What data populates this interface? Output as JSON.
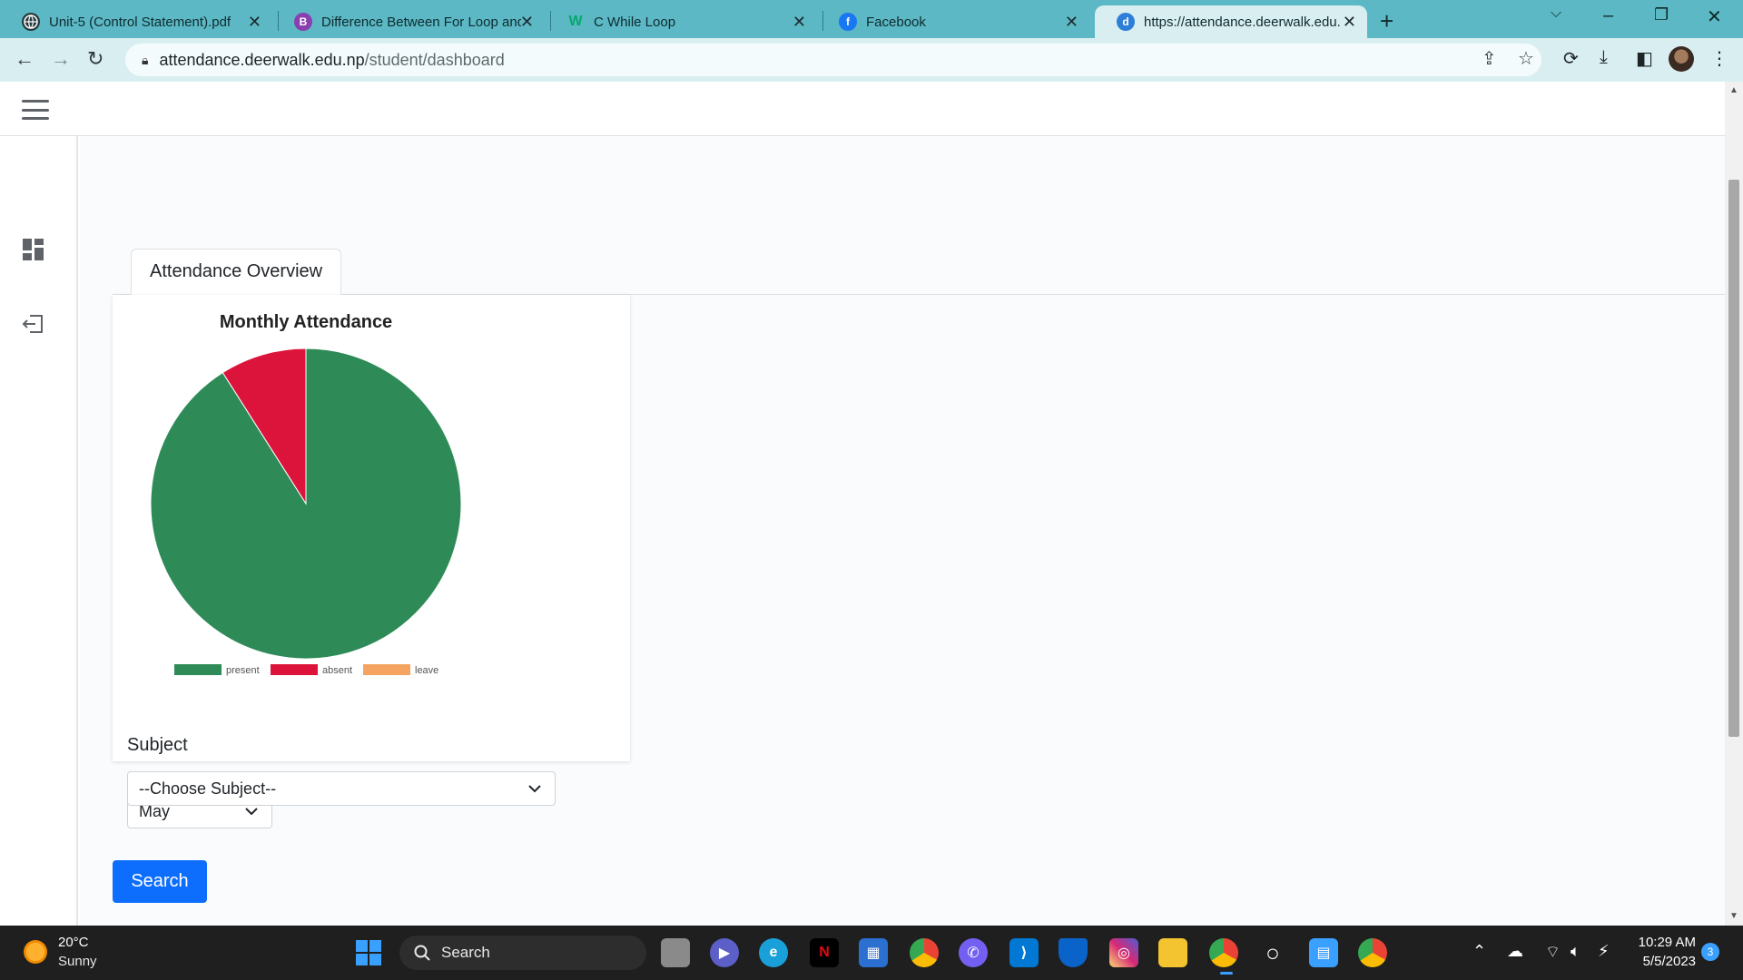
{
  "browser": {
    "tabs": [
      {
        "title": "Unit-5 (Control Statement).pdf",
        "favicon": "globe-icon",
        "active": false
      },
      {
        "title": "Difference Between For Loop and",
        "favicon": "byjus-icon",
        "active": false
      },
      {
        "title": "C While Loop",
        "favicon": "w3schools-icon",
        "active": false
      },
      {
        "title": "Facebook",
        "favicon": "facebook-icon",
        "active": false
      },
      {
        "title": "https://attendance.deerwalk.edu.",
        "favicon": "deerwalk-icon",
        "active": true
      }
    ],
    "url_host": "attendance.deerwalk.edu.np",
    "url_path": "/student/dashboard"
  },
  "page": {
    "tab_label": "Attendance Overview",
    "month_select": {
      "value": "May"
    },
    "subject_label": "Subject",
    "subject_select": {
      "value": "--Choose Subject--"
    },
    "search_label": "Search"
  },
  "chart_data": {
    "type": "pie",
    "title": "Monthly Attendance",
    "categories": [
      "present",
      "absent",
      "leave"
    ],
    "values": [
      91,
      9,
      0
    ],
    "colors": [
      "#2e8b57",
      "#dc143c",
      "#f4a460"
    ],
    "legend_position": "bottom"
  },
  "taskbar": {
    "weather_temp": "20°C",
    "weather_desc": "Sunny",
    "search_placeholder": "Search",
    "time": "10:29 AM",
    "date": "5/5/2023",
    "notification_count": "3"
  },
  "colors": {
    "tabbar": "#5bb8c4",
    "toolbar": "#d9eef1",
    "primary_button": "#0d6efd"
  }
}
